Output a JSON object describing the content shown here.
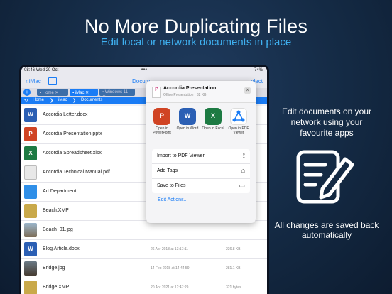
{
  "hero": {
    "title": "No More Duplicating Files",
    "subtitle": "Edit local or network documents in place"
  },
  "status_bar": {
    "time": "08:46",
    "date": "Wed 20 Oct",
    "battery": "74%"
  },
  "nav": {
    "back_label": "iMac",
    "title": "Docum",
    "select_label": "elect"
  },
  "tabs": [
    {
      "label": "Home"
    },
    {
      "label": "iMac"
    },
    {
      "label": "Windows 11"
    }
  ],
  "breadcrumb": {
    "home": "Home",
    "mid": "iMac",
    "current": "Documents"
  },
  "files": [
    {
      "name": "Accordia Letter.docx",
      "type": "word",
      "date": "",
      "size": ""
    },
    {
      "name": "Accordia Presentation.pptx",
      "type": "ppt",
      "date": "",
      "size": ""
    },
    {
      "name": "Accordia Spreadsheet.xlsx",
      "type": "xls",
      "date": "",
      "size": ""
    },
    {
      "name": "Accordia Technical Manual.pdf",
      "type": "pdf",
      "date": "",
      "size": ""
    },
    {
      "name": "Art Department",
      "type": "folder",
      "date": "",
      "size": ""
    },
    {
      "name": "Beach.XMP",
      "type": "xmp",
      "date": "",
      "size": ""
    },
    {
      "name": "Beach_01.jpg",
      "type": "img1",
      "date": "",
      "size": ""
    },
    {
      "name": "Blog Article.docx",
      "type": "word",
      "date": "26 Apr 2018 at 13:17:11",
      "size": "236.8 KB"
    },
    {
      "name": "Bridge.jpg",
      "type": "img2",
      "date": "14 Feb 2018 at 14:44:59",
      "size": "281.1 KB"
    },
    {
      "name": "Bridge.XMP",
      "type": "xmp",
      "date": "20 Apr 2021 at 12:47:29",
      "size": "321 bytes"
    }
  ],
  "popup": {
    "file_name": "Accordia Presentation",
    "file_meta": "Office Presentation · 32 KB",
    "apps": [
      {
        "label": "Open in PowerPoint",
        "letter": "P",
        "color": "#d04424"
      },
      {
        "label": "Open in Word",
        "letter": "W",
        "color": "#2b5fb4"
      },
      {
        "label": "Open in Excel",
        "letter": "X",
        "color": "#1d7a43"
      },
      {
        "label": "Open in PDF Viewer",
        "letter": "",
        "color": "#ffffff"
      }
    ],
    "actions": [
      {
        "label": "Import to PDF Viewer",
        "icon": "pdf-viewer-icon"
      },
      {
        "label": "Add Tags",
        "icon": "tag-icon"
      },
      {
        "label": "Save to Files",
        "icon": "folder-icon"
      }
    ],
    "edit_actions": "Edit Actions..."
  },
  "side": {
    "top_text": "Edit documents on your network using your favourite apps",
    "bottom_text": "All changes are saved back automatically"
  },
  "colors": {
    "accent": "#1a7cf5",
    "subtitle": "#3fb0f0",
    "background": "#142a44"
  }
}
